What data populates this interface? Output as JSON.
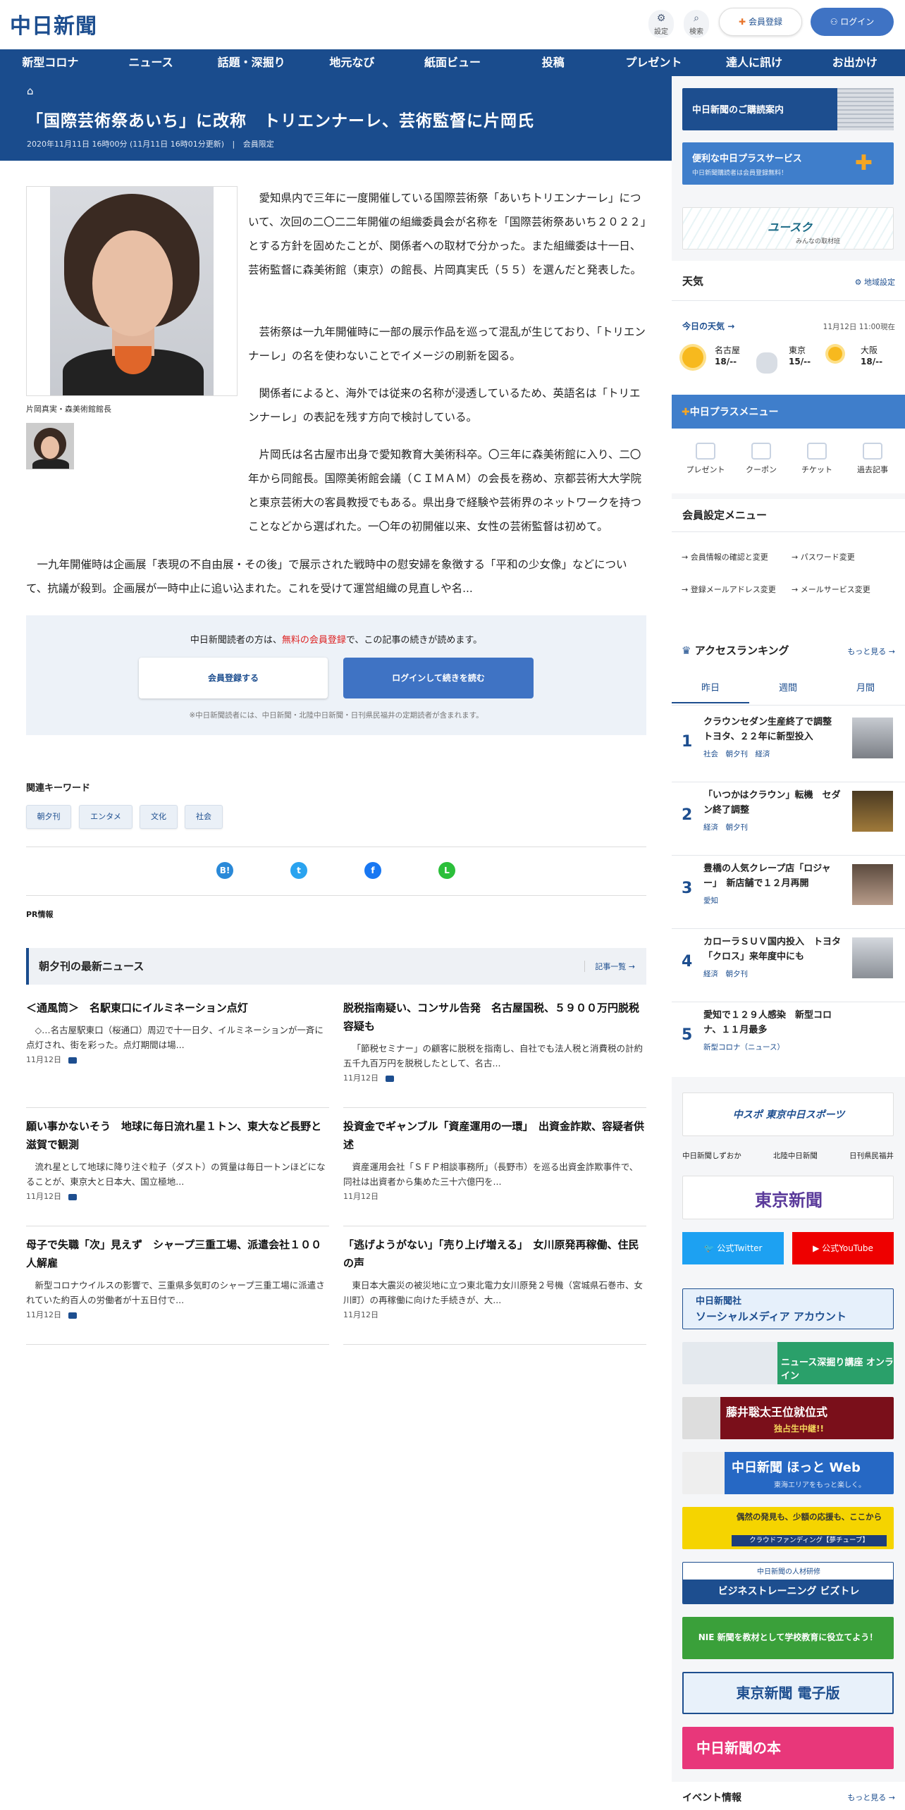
{
  "header": {
    "logo": "中日新聞",
    "settings_label": "設定",
    "search_label": "検索",
    "register_label": "会員登録",
    "login_label": "ログイン"
  },
  "nav": [
    "新型コロナ",
    "ニュース",
    "話題・深掘り",
    "地元なび",
    "紙面ビュー",
    "投稿",
    "プレゼント",
    "達人に訊け",
    "お出かけ"
  ],
  "article": {
    "title": "「国際芸術祭あいち」に改称　トリエンナーレ、芸術監督に片岡氏",
    "date": "2020年11月11日 16時00分 (11月11日 16時01分更新)",
    "members_only": "会員限定",
    "caption": "片岡真実・森美術館館長",
    "paragraphs": [
      "愛知県内で三年に一度開催している国際芸術祭「あいちトリエンナーレ」について、次回の二〇二二年開催の組織委員会が名称を「国際芸術祭あいち２０２２」とする方針を固めたことが、関係者への取材で分かった。また組織委は十一日、芸術監督に森美術館（東京）の館長、片岡真実氏（５５）を選んだと発表した。",
      "芸術祭は一九年開催時に一部の展示作品を巡って混乱が生じており、「トリエンナーレ」の名を使わないことでイメージの刷新を図る。",
      "関係者によると、海外では従来の名称が浸透しているため、英語名は「トリエンナーレ」の表記を残す方向で検討している。",
      "片岡氏は名古屋市出身で愛知教育大美術科卒。〇三年に森美術館に入り、二〇年から同館長。国際美術館会議（ＣＩＭＡＭ）の会長を務め、京都芸術大大学院と東京芸術大の客員教授でもある。県出身で経験や芸術界のネットワークを持つことなどから選ばれた。一〇年の初開催以来、女性の芸術監督は初めて。",
      "一九年開催時は企画展「表現の不自由展・その後」で展示された戦時中の慰安婦を象徴する「平和の少女像」などについて、抗議が殺到。企画展が一時中止に追い込まれた。これを受けて運営組織の見直しや名..."
    ]
  },
  "paywall": {
    "text_before": "中日新聞読者の方は、",
    "text_link": "無料の会員登録",
    "text_after": "で、この記事の続きが読めます。",
    "register_button": "会員登録する",
    "login_button": "ログインして続きを読む",
    "note": "※中日新聞読者には、中日新聞・北陸中日新聞・日刊県民福井の定期読者が含まれます。"
  },
  "keywords": {
    "title": "関連キーワード",
    "items": [
      "朝夕刊",
      "エンタメ",
      "文化",
      "社会"
    ]
  },
  "pr_label": "PR情報",
  "latest": {
    "title": "朝夕刊の最新ニュース",
    "more": "記事一覧",
    "items": [
      {
        "headline": "＜通風筒＞　名駅東口にイルミネーション点灯",
        "desc": "◇…名古屋駅東口（桜通口）周辺で十一日夕、イルミネーションが一斉に点灯され、街を彩った。点灯期間は場...",
        "date": "11月12日",
        "photo": true
      },
      {
        "headline": "脱税指南疑い、コンサル告発　名古屋国税、５９００万円脱税容疑も",
        "desc": "「節税セミナー」の顧客に脱税を指南し、自社でも法人税と消費税の計約五千九百万円を脱税したとして、名古...",
        "date": "11月12日",
        "photo": true
      },
      {
        "headline": "願い事かないそう　地球に毎日流れ星１トン、東大など長野と滋賀で観測",
        "desc": "流れ星として地球に降り注ぐ粒子（ダスト）の質量は毎日一トンほどになることが、東京大と日本大、国立極地...",
        "date": "11月12日",
        "photo": true
      },
      {
        "headline": "投資金でギャンブル「資産運用の一環」　出資金詐欺、容疑者供述",
        "desc": "資産運用会社「ＳＦＰ相談事務所」（長野市）を巡る出資金詐欺事件で、同社は出資者から集めた三十六億円を...",
        "date": "11月12日",
        "photo": true
      },
      {
        "headline": "母子で失職「次」見えず　シャープ三重工場、派遣会社１００人解雇",
        "desc": "新型コロナウイルスの影響で、三重県多気町のシャープ三重工場に派遣されていた約百人の労働者が十五日付で...",
        "date": "11月12日",
        "photo": true
      },
      {
        "headline": "「逃げようがない」「売り上げ増える」　女川原発再稼働、住民の声",
        "desc": "東日本大震災の被災地に立つ東北電力女川原発２号機（宮城県石巻市、女川町）の再稼働に向けた手続きが、大...",
        "date": "11月12日",
        "photo": false
      }
    ]
  },
  "sidebar": {
    "banner_subscribe": "中日新聞のご購読案内",
    "banner_plus": "便利な中日プラスサービス",
    "banner_plus_sub": "中日新聞購読者は会員登録無料！",
    "banner_scoop": "ユースク",
    "banner_scoop_sub": "みんなの取材班",
    "weather": {
      "title": "天気",
      "region": "地域設定",
      "today": "今日の天気",
      "updated": "11月12日 11:00現在",
      "cities": [
        {
          "name": "名古屋",
          "temp": "18/--",
          "icon": "sun"
        },
        {
          "name": "東京",
          "temp": "15/--",
          "icon": "cloud"
        },
        {
          "name": "大阪",
          "temp": "18/--",
          "icon": "sun-cloud"
        }
      ]
    },
    "plus_menu": {
      "title": "中日プラスメニュー",
      "items": [
        "プレゼント",
        "クーポン",
        "チケット",
        "過去記事"
      ]
    },
    "member_menu": {
      "title": "会員設定メニュー",
      "links": [
        "会員情報の確認と変更",
        "パスワード変更",
        "登録メールアドレス変更",
        "メールサービス変更"
      ]
    },
    "ranking": {
      "title": "アクセスランキング",
      "more": "もっと見る",
      "tabs": [
        "昨日",
        "週間",
        "月間"
      ],
      "items": [
        {
          "rank": "1",
          "headline": "クラウンセダン生産終了で調整　トヨタ、２２年に新型投入",
          "tags": "社会　朝夕刊　経済"
        },
        {
          "rank": "2",
          "headline": "「いつかはクラウン」転機　セダン終了調整",
          "tags": "経済　朝夕刊"
        },
        {
          "rank": "3",
          "headline": "豊橋の人気クレープ店「ロジャー」　新店舗で１２月再開",
          "tags": "愛知"
        },
        {
          "rank": "4",
          "headline": "カローラＳＵＶ国内投入　トヨタ「クロス」来年度中にも",
          "tags": "経済　朝夕刊"
        },
        {
          "rank": "5",
          "headline": "愛知で１２９人感染　新型コロナ、１１月最多",
          "tags": "新型コロナ（ニュース）"
        }
      ]
    },
    "chunichi_sports": "中スポ 東京中日スポーツ",
    "group_links": [
      "中日新聞しずおか",
      "北陸中日新聞",
      "日刊県民福井"
    ],
    "tokyo_shimbun": "東京新聞",
    "twitter": "公式Twitter",
    "youtube": "公式YouTube",
    "social_banner_1": "中日新聞社",
    "social_banner_2": "ソーシャルメディア アカウント",
    "banner_fukabori": "ニュース深掘り講座 オンライン",
    "banner_fujii": "藤井聡太王位就位式",
    "banner_fujii_sub": "独占生中継!!",
    "banner_hotto": "中日新聞 ほっと Web",
    "banner_hotto_sub": "東海エリアをもっと楽しく。",
    "banner_yume": "偶然の発見も、少額の応援も、ここから",
    "banner_yume_sub": "クラウドファンディング【夢チューブ】",
    "banner_biz": "中日新聞の人材研修",
    "banner_biz_sub": "ビジネストレーニング ビズトレ",
    "banner_nie": "NIE 新聞を教材として学校教育に役立てよう！",
    "banner_tokyo_e": "東京新聞 電子版",
    "banner_books": "中日新聞の本",
    "events_title": "イベント情報",
    "events_more": "もっと見る"
  },
  "colors": {
    "brand": "#1a4c8d",
    "accent": "#3f73c4",
    "alert": "#dd2222"
  }
}
